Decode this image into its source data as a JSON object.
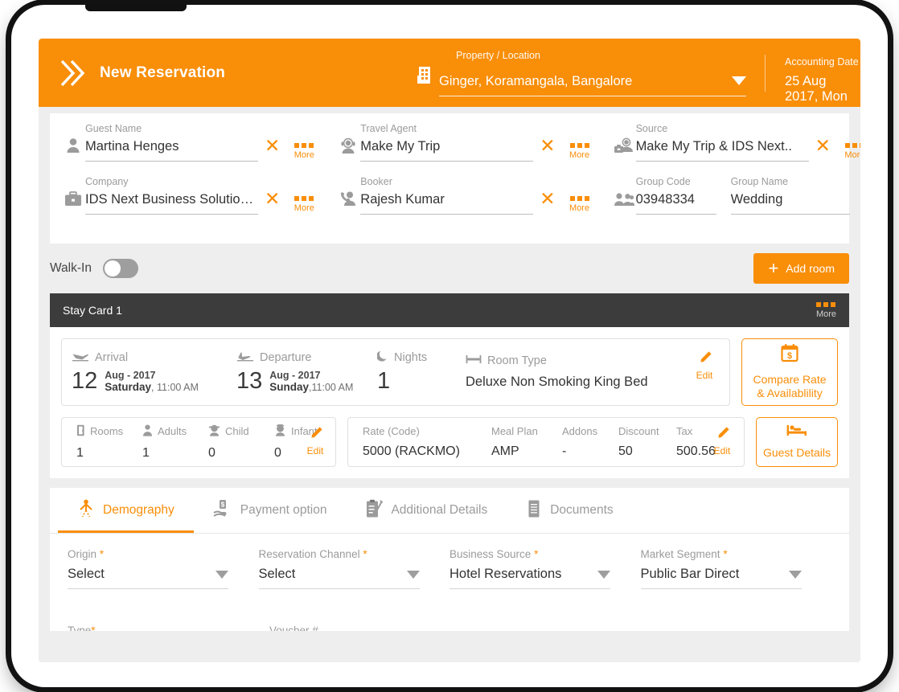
{
  "header": {
    "logo_icon": "double-chevron-icon",
    "title": "New Reservation",
    "property_label": "Property / Location",
    "property_value": "Ginger, Koramangala, Bangalore",
    "property_icon": "building-icon",
    "accounting_label": "Accounting Date",
    "accounting_value": "25 Aug 2017, Mon",
    "accent_color": "#F98E08"
  },
  "guest": {
    "fields": [
      {
        "label": "Guest Name",
        "value": "Martina Henges",
        "icon": "person-icon",
        "clear": "✕",
        "more": "More"
      },
      {
        "label": "Travel Agent",
        "value": "Make My Trip",
        "icon": "agent-headset-icon",
        "clear": "✕",
        "more": "More"
      },
      {
        "label": "Source",
        "value": "Make My Trip & IDS Next..",
        "icon": "source-agent-icon",
        "clear": "✕",
        "more": "More"
      },
      {
        "label": "Company",
        "value": "IDS Next Business Solutio…",
        "icon": "briefcase-icon",
        "clear": "✕",
        "more": "More"
      },
      {
        "label": "Booker",
        "value": "Rajesh Kumar",
        "icon": "phone-person-icon",
        "clear": "✕",
        "more": "More"
      },
      {
        "label": "Group Code",
        "value": "03948334",
        "icon": "group-people-icon"
      },
      {
        "label": "Group Name",
        "value": "Wedding"
      }
    ]
  },
  "walkin": {
    "label": "Walk-In",
    "toggle_state": "off",
    "add_room_label": "Add room",
    "add_room_icon": "plus-icon"
  },
  "stay_card": {
    "title": "Stay Card 1",
    "more_label": "More",
    "arrival": {
      "label": "Arrival",
      "icon": "plane-arrival-icon",
      "day": "12",
      "month_year": "Aug - 2017",
      "weekday": "Saturday",
      "time": "11:00 AM"
    },
    "departure": {
      "label": "Departure",
      "icon": "plane-departure-icon",
      "day": "13",
      "month_year": "Aug - 2017",
      "weekday": "Sunday",
      "time": "11:00 AM"
    },
    "nights": {
      "label": "Nights",
      "icon": "moon-icon",
      "value": "1"
    },
    "room_type": {
      "label": "Room Type",
      "icon": "bed-icon",
      "value": "Deluxe Non Smoking King Bed"
    },
    "edit_label": "Edit",
    "compare_button": {
      "line1": "Compare Rate",
      "line2": "& Availablility",
      "icon": "calendar-dollar-icon"
    },
    "occupancy": [
      {
        "label": "Rooms",
        "icon": "door-icon",
        "value": "1"
      },
      {
        "label": "Adults",
        "icon": "adult-icon",
        "value": "1"
      },
      {
        "label": "Child",
        "icon": "child-icon",
        "value": "0"
      },
      {
        "label": "Infant",
        "icon": "infant-icon",
        "value": "0"
      }
    ],
    "rate": [
      {
        "label": "Rate (Code)",
        "value": "5000  (RACKMO)"
      },
      {
        "label": "Meal Plan",
        "value": "AMP"
      },
      {
        "label": "Addons",
        "value": "-"
      },
      {
        "label": "Discount",
        "value": "50"
      },
      {
        "label": "Tax",
        "value": "500.56"
      }
    ],
    "guest_details_button": {
      "label": "Guest Details",
      "icon": "bed-guest-icon"
    }
  },
  "tabs": [
    {
      "label": "Demography",
      "icon": "demography-icon",
      "active": true
    },
    {
      "label": "Payment option",
      "icon": "payment-hand-icon",
      "active": false
    },
    {
      "label": "Additional Details",
      "icon": "clipboard-pen-icon",
      "active": false
    },
    {
      "label": "Documents",
      "icon": "documents-icon",
      "active": false
    }
  ],
  "demography_form": {
    "row1": [
      {
        "label": "Origin",
        "required": "*",
        "value": "Select"
      },
      {
        "label": "Reservation Channel",
        "required": "*",
        "value": "Select"
      },
      {
        "label": "Business Source",
        "required": "*",
        "value": "Hotel Reservations"
      },
      {
        "label": "Market Segment",
        "required": "*",
        "value": "Public Bar Direct"
      }
    ],
    "row2": [
      {
        "label": "Type",
        "required": "*",
        "value": ""
      },
      {
        "label": "Voucher #",
        "required": "",
        "value": ""
      }
    ]
  }
}
